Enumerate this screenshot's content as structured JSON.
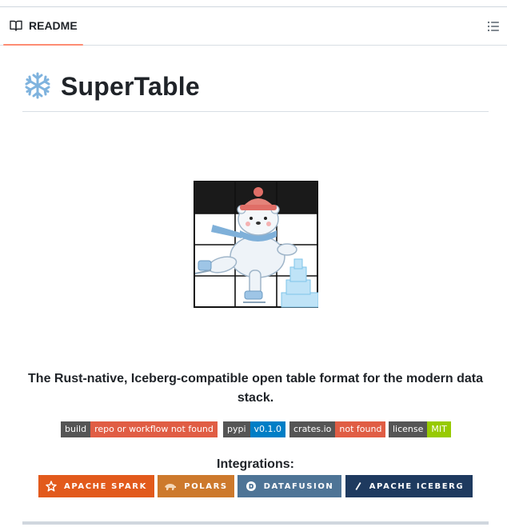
{
  "tab": {
    "label": "README",
    "icon": "book-icon"
  },
  "toc": {
    "icon": "list-unordered-icon"
  },
  "heading": {
    "emoji": "snowflake-icon",
    "title": "SuperTable"
  },
  "logo": {
    "name": "polar-bear-skating-logo"
  },
  "tagline": "The Rust-native, Iceberg-compatible open table format for the modern data stack.",
  "status_badges": [
    {
      "label": "build",
      "value": "repo or workflow not found",
      "color": "#e05d44"
    },
    {
      "label": "pypi",
      "value": "v0.1.0",
      "color": "#007ec6"
    },
    {
      "label": "crates.io",
      "value": "not found",
      "color": "#e05d44"
    },
    {
      "label": "license",
      "value": "MIT",
      "color": "#97ca00"
    }
  ],
  "integrations": {
    "title": "Integrations:",
    "items": [
      {
        "label": "APACHE SPARK",
        "icon": "spark-star-icon",
        "color": "#e25a1c"
      },
      {
        "label": "POLARS",
        "icon": "polar-bear-icon",
        "color": "#cd792c"
      },
      {
        "label": "DATAFUSION",
        "icon": "datafusion-icon",
        "color": "#4e7496"
      },
      {
        "label": "APACHE ICEBERG",
        "icon": "iceberg-icon",
        "color": "#1e3a5f"
      }
    ]
  }
}
